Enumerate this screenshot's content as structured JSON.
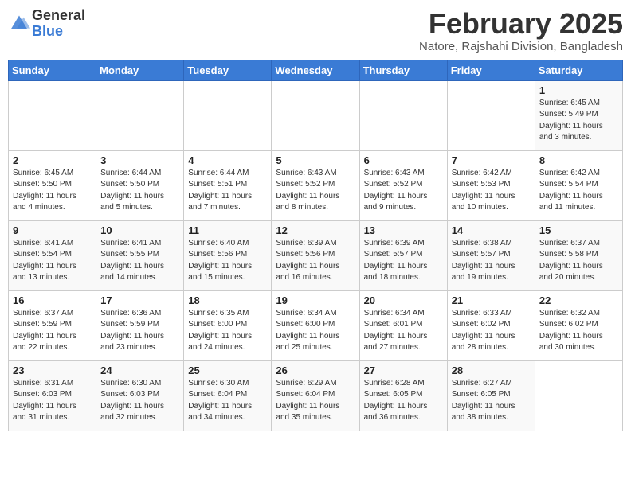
{
  "logo": {
    "general": "General",
    "blue": "Blue"
  },
  "title": "February 2025",
  "location": "Natore, Rajshahi Division, Bangladesh",
  "weekdays": [
    "Sunday",
    "Monday",
    "Tuesday",
    "Wednesday",
    "Thursday",
    "Friday",
    "Saturday"
  ],
  "weeks": [
    [
      {
        "day": "",
        "info": ""
      },
      {
        "day": "",
        "info": ""
      },
      {
        "day": "",
        "info": ""
      },
      {
        "day": "",
        "info": ""
      },
      {
        "day": "",
        "info": ""
      },
      {
        "day": "",
        "info": ""
      },
      {
        "day": "1",
        "info": "Sunrise: 6:45 AM\nSunset: 5:49 PM\nDaylight: 11 hours\nand 3 minutes."
      }
    ],
    [
      {
        "day": "2",
        "info": "Sunrise: 6:45 AM\nSunset: 5:50 PM\nDaylight: 11 hours\nand 4 minutes."
      },
      {
        "day": "3",
        "info": "Sunrise: 6:44 AM\nSunset: 5:50 PM\nDaylight: 11 hours\nand 5 minutes."
      },
      {
        "day": "4",
        "info": "Sunrise: 6:44 AM\nSunset: 5:51 PM\nDaylight: 11 hours\nand 7 minutes."
      },
      {
        "day": "5",
        "info": "Sunrise: 6:43 AM\nSunset: 5:52 PM\nDaylight: 11 hours\nand 8 minutes."
      },
      {
        "day": "6",
        "info": "Sunrise: 6:43 AM\nSunset: 5:52 PM\nDaylight: 11 hours\nand 9 minutes."
      },
      {
        "day": "7",
        "info": "Sunrise: 6:42 AM\nSunset: 5:53 PM\nDaylight: 11 hours\nand 10 minutes."
      },
      {
        "day": "8",
        "info": "Sunrise: 6:42 AM\nSunset: 5:54 PM\nDaylight: 11 hours\nand 11 minutes."
      }
    ],
    [
      {
        "day": "9",
        "info": "Sunrise: 6:41 AM\nSunset: 5:54 PM\nDaylight: 11 hours\nand 13 minutes."
      },
      {
        "day": "10",
        "info": "Sunrise: 6:41 AM\nSunset: 5:55 PM\nDaylight: 11 hours\nand 14 minutes."
      },
      {
        "day": "11",
        "info": "Sunrise: 6:40 AM\nSunset: 5:56 PM\nDaylight: 11 hours\nand 15 minutes."
      },
      {
        "day": "12",
        "info": "Sunrise: 6:39 AM\nSunset: 5:56 PM\nDaylight: 11 hours\nand 16 minutes."
      },
      {
        "day": "13",
        "info": "Sunrise: 6:39 AM\nSunset: 5:57 PM\nDaylight: 11 hours\nand 18 minutes."
      },
      {
        "day": "14",
        "info": "Sunrise: 6:38 AM\nSunset: 5:57 PM\nDaylight: 11 hours\nand 19 minutes."
      },
      {
        "day": "15",
        "info": "Sunrise: 6:37 AM\nSunset: 5:58 PM\nDaylight: 11 hours\nand 20 minutes."
      }
    ],
    [
      {
        "day": "16",
        "info": "Sunrise: 6:37 AM\nSunset: 5:59 PM\nDaylight: 11 hours\nand 22 minutes."
      },
      {
        "day": "17",
        "info": "Sunrise: 6:36 AM\nSunset: 5:59 PM\nDaylight: 11 hours\nand 23 minutes."
      },
      {
        "day": "18",
        "info": "Sunrise: 6:35 AM\nSunset: 6:00 PM\nDaylight: 11 hours\nand 24 minutes."
      },
      {
        "day": "19",
        "info": "Sunrise: 6:34 AM\nSunset: 6:00 PM\nDaylight: 11 hours\nand 25 minutes."
      },
      {
        "day": "20",
        "info": "Sunrise: 6:34 AM\nSunset: 6:01 PM\nDaylight: 11 hours\nand 27 minutes."
      },
      {
        "day": "21",
        "info": "Sunrise: 6:33 AM\nSunset: 6:02 PM\nDaylight: 11 hours\nand 28 minutes."
      },
      {
        "day": "22",
        "info": "Sunrise: 6:32 AM\nSunset: 6:02 PM\nDaylight: 11 hours\nand 30 minutes."
      }
    ],
    [
      {
        "day": "23",
        "info": "Sunrise: 6:31 AM\nSunset: 6:03 PM\nDaylight: 11 hours\nand 31 minutes."
      },
      {
        "day": "24",
        "info": "Sunrise: 6:30 AM\nSunset: 6:03 PM\nDaylight: 11 hours\nand 32 minutes."
      },
      {
        "day": "25",
        "info": "Sunrise: 6:30 AM\nSunset: 6:04 PM\nDaylight: 11 hours\nand 34 minutes."
      },
      {
        "day": "26",
        "info": "Sunrise: 6:29 AM\nSunset: 6:04 PM\nDaylight: 11 hours\nand 35 minutes."
      },
      {
        "day": "27",
        "info": "Sunrise: 6:28 AM\nSunset: 6:05 PM\nDaylight: 11 hours\nand 36 minutes."
      },
      {
        "day": "28",
        "info": "Sunrise: 6:27 AM\nSunset: 6:05 PM\nDaylight: 11 hours\nand 38 minutes."
      },
      {
        "day": "",
        "info": ""
      }
    ]
  ]
}
